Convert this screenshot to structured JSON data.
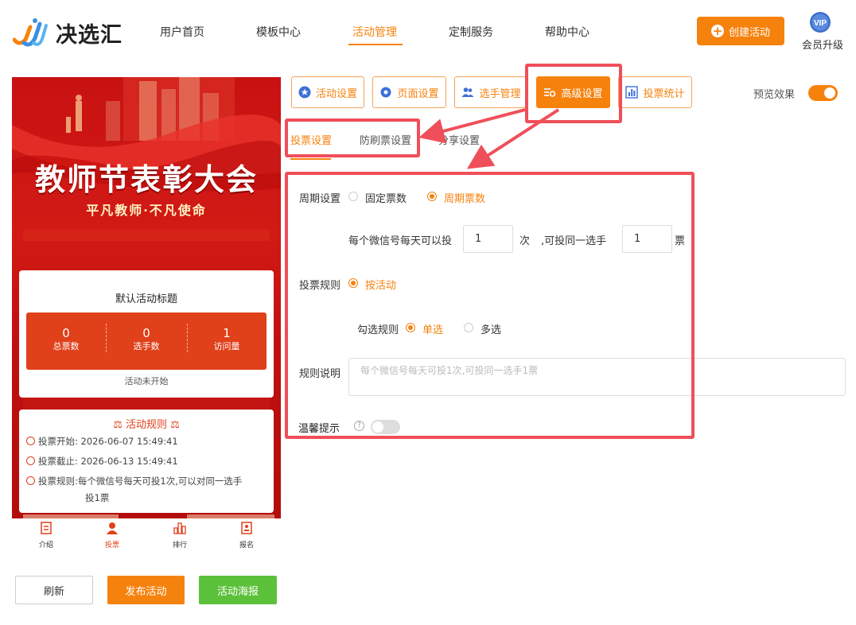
{
  "brand": {
    "name": "决选汇"
  },
  "nav": [
    {
      "label": "用户首页"
    },
    {
      "label": "模板中心"
    },
    {
      "label": "活动管理"
    },
    {
      "label": "定制服务"
    },
    {
      "label": "帮助中心"
    }
  ],
  "header": {
    "create_label": "创建活动",
    "vip_badge": "VIP",
    "vip_label": "会员升级"
  },
  "phone": {
    "poster_title": "教师节表彰大会",
    "poster_subtitle": "平凡教师·不凡使命",
    "activity_title": "默认活动标题",
    "stats": [
      {
        "value": "0",
        "label": "总票数"
      },
      {
        "value": "0",
        "label": "选手数"
      },
      {
        "value": "1",
        "label": "访问量"
      }
    ],
    "status": "活动未开始",
    "rules_title": "活动规则",
    "rules": {
      "start_label": "投票开始:",
      "start_value": "2026-06-07 15:49:41",
      "end_label": "投票截止:",
      "end_value": "2026-06-13 15:49:41",
      "rule_label": "投票规则:",
      "rule_value_1": "每个微信号每天可投1次,可以对同一选手",
      "rule_value_2": "投1票"
    },
    "bottom_nav": [
      {
        "label": "介绍"
      },
      {
        "label": "投票"
      },
      {
        "label": "排行"
      },
      {
        "label": "报名"
      }
    ]
  },
  "actions": {
    "refresh": "刷新",
    "publish": "发布活动",
    "poster": "活动海报"
  },
  "tabs": [
    {
      "label": "活动设置"
    },
    {
      "label": "页面设置"
    },
    {
      "label": "选手管理"
    },
    {
      "label": "高级设置"
    },
    {
      "label": "投票统计"
    }
  ],
  "preview": {
    "label": "预览效果"
  },
  "subtabs": [
    {
      "label": "投票设置"
    },
    {
      "label": "防刷票设置"
    },
    {
      "label": "分享设置"
    }
  ],
  "form": {
    "period_label": "周期设置",
    "period_options": [
      "固定票数",
      "周期票数"
    ],
    "per_day_prefix": "每个微信号每天可以投",
    "per_day_value": "1",
    "per_day_unit": "次",
    "same_prefix": ",可投同一选手",
    "same_value": "1",
    "same_unit": "票",
    "vote_rule_label": "投票规则",
    "vote_rule_option": "按活动",
    "select_rule_label": "勾选规则",
    "select_options": [
      "单选",
      "多选"
    ],
    "rule_desc_label": "规则说明",
    "rule_desc_placeholder": "每个微信号每天可投1次,可投同一选手1票",
    "tip_label": "温馨提示"
  }
}
